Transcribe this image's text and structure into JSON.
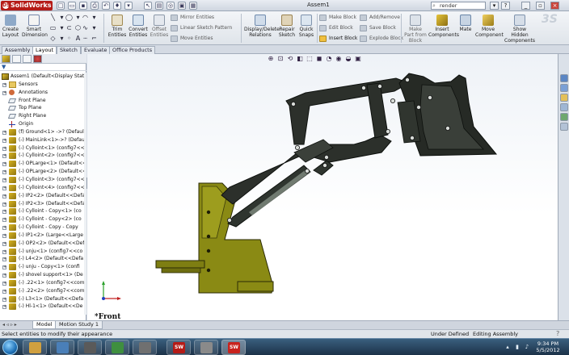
{
  "app": {
    "logo_text": "SolidWorks",
    "window_title": "Assem1",
    "search_value": "render"
  },
  "ribbon": {
    "create_layout": "Create\nLayout",
    "smart_dimension": "Smart\nDimension",
    "trim_entities": "Trim\nEntities",
    "convert_entities": "Convert\nEntities",
    "offset_entities": "Offset\nEntities",
    "mirror_entities": "Mirror Entities",
    "linear_sketch_pattern": "Linear Sketch Pattern",
    "move_entities": "Move Entities",
    "display_delete_relations": "Display/Delete\nRelations",
    "repair_sketch": "Repair\nSketch",
    "quick_snaps": "Quick\nSnaps",
    "make_block": "Make Block",
    "edit_block": "Edit Block",
    "insert_block": "Insert Block",
    "add_remove": "Add/Remove",
    "save_block": "Save Block",
    "explode_block": "Explode Block",
    "make_part_from_block": "Make\nPart from\nBlock",
    "insert_components": "Insert\nComponents",
    "mate": "Mate",
    "move_component": "Move\nComponent",
    "show_hidden_components": "Show\nHidden\nComponents"
  },
  "command_tabs": [
    "Assembly",
    "Layout",
    "Sketch",
    "Evaluate",
    "Office Products"
  ],
  "tree": {
    "root": "Assem1  (Default<Display State-",
    "items": [
      "Sensors",
      "Annotations",
      "Front Plane",
      "Top Plane",
      "Right Plane",
      "Origin",
      "(f) Ground<1> ->? (Defaul",
      "(-) MainLink<1>->? (Defaul",
      "(-) Cylloint<1> (config7<<",
      "(-) Cylloint<2> (config7<<",
      "(-) OPLarge<1> (Default<<",
      "(-) OPLarge<2> (Default<<",
      "(-) Cylloint<3> (config7<<",
      "(-) Cylloint<4> (config7<<",
      "(-) IP2<2> (Default<<Defa",
      "(-) IP2<3> (Default<<Defa",
      "(-) Cylloint - Copy<1> (co",
      "(-) Cylloint - Copy<2> (co",
      "(-) Cylloint - Copy - Copy",
      "(-) IP1<2> (Large<<Large",
      "(-) OP2<2> (Default<<Defa",
      "(-) unju<1> (config7<<co",
      "(-) L4<2> (Default<<Defa",
      "(-) unju - Copy<1> (confi",
      "(-) shovel support<1> (De",
      "(-) .22<1> (config7<<com",
      "(-) .22<2> (config7<<com",
      "(-) L3<1> (Default<<Defa",
      "(-) Hl-1<1> (Default<<De"
    ]
  },
  "viewport": {
    "view_label": "*Front"
  },
  "bottom_tabs": [
    "Model",
    "Motion Study 1"
  ],
  "status": {
    "message": "Select entities to modify their appearance",
    "define_state": "Under Defined",
    "edit_state": "Editing Assembly"
  },
  "taskbar": {
    "time": "9:34 PM",
    "date": "5/5/2012",
    "app1": "SW",
    "app2": "SW"
  },
  "colors": {
    "part_yellow": "#8a8a14",
    "part_dark": "#2c302b",
    "accent_red": "#b51b17"
  }
}
